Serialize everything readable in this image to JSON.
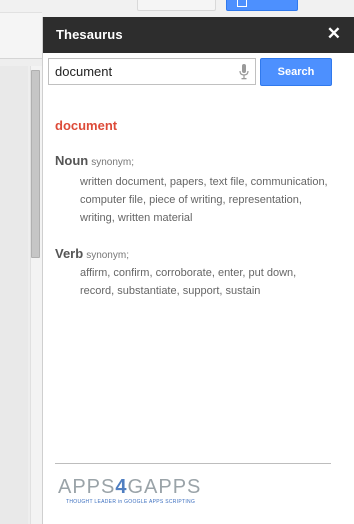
{
  "sidebar": {
    "title": "Thesaurus",
    "close_glyph": "✕",
    "search": {
      "value": "document",
      "button_label": "Search"
    },
    "result": {
      "word": "document",
      "groups": [
        {
          "pos": "Noun",
          "type": "synonym;",
          "lines": [
            "written document, papers, text file, communication,",
            "computer file, piece of writing, representation,",
            "writing, written material"
          ]
        },
        {
          "pos": "Verb",
          "type": "synonym;",
          "lines": [
            "affirm, confirm, corroborate, enter, put down,",
            "record, substantiate, support, sustain"
          ]
        }
      ]
    },
    "footer": {
      "logo_left": "APPS",
      "logo_mid": "4",
      "logo_right": "GAPPS",
      "tagline": "THOUGHT LEADER in GOOGLE APPS SCRIPTING"
    }
  },
  "colors": {
    "header_bg": "#2d2d2d",
    "accent_blue": "#4d90fe",
    "result_red": "#dd4b39"
  },
  "icons": {
    "close": "close-icon",
    "mic": "microphone-icon"
  }
}
